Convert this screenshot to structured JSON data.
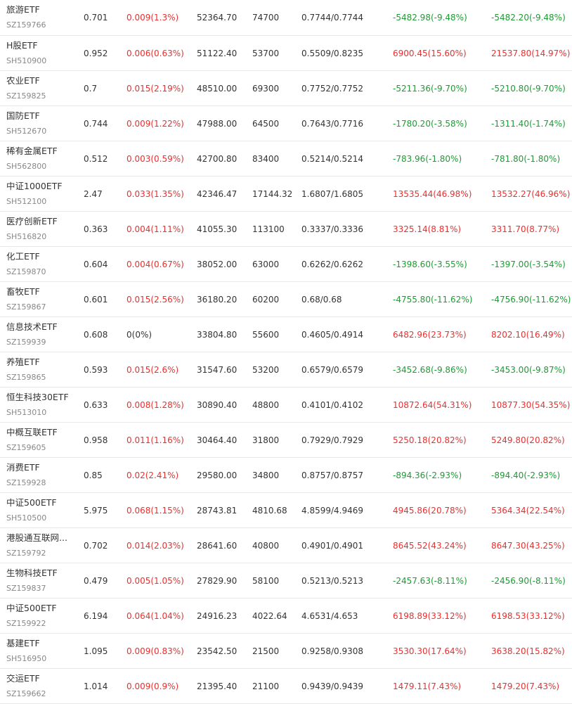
{
  "colors": {
    "up": "#e93030",
    "down": "#1e9b34",
    "flat": "#333333",
    "code_text": "#888888",
    "divider": "#e8e8e8"
  },
  "rows": [
    {
      "name": "旅游ETF",
      "code": "SZ159766",
      "price": "0.701",
      "change": "0.009(1.3%)",
      "change_dir": "up",
      "value": "52364.70",
      "shares": "74700",
      "cost": "0.7744/0.7744",
      "pl1": "-5482.98(-9.48%)",
      "pl1_dir": "down",
      "pl2": "-5482.20(-9.48%)",
      "pl2_dir": "down"
    },
    {
      "name": "H股ETF",
      "code": "SH510900",
      "price": "0.952",
      "change": "0.006(0.63%)",
      "change_dir": "up",
      "value": "51122.40",
      "shares": "53700",
      "cost": "0.5509/0.8235",
      "pl1": "6900.45(15.60%)",
      "pl1_dir": "up",
      "pl2": "21537.80(14.97%)",
      "pl2_dir": "up"
    },
    {
      "name": "农业ETF",
      "code": "SZ159825",
      "price": "0.7",
      "change": "0.015(2.19%)",
      "change_dir": "up",
      "value": "48510.00",
      "shares": "69300",
      "cost": "0.7752/0.7752",
      "pl1": "-5211.36(-9.70%)",
      "pl1_dir": "down",
      "pl2": "-5210.80(-9.70%)",
      "pl2_dir": "down"
    },
    {
      "name": "国防ETF",
      "code": "SH512670",
      "price": "0.744",
      "change": "0.009(1.22%)",
      "change_dir": "up",
      "value": "47988.00",
      "shares": "64500",
      "cost": "0.7643/0.7716",
      "pl1": "-1780.20(-3.58%)",
      "pl1_dir": "down",
      "pl2": "-1311.40(-1.74%)",
      "pl2_dir": "down"
    },
    {
      "name": "稀有金属ETF",
      "code": "SH562800",
      "price": "0.512",
      "change": "0.003(0.59%)",
      "change_dir": "up",
      "value": "42700.80",
      "shares": "83400",
      "cost": "0.5214/0.5214",
      "pl1": "-783.96(-1.80%)",
      "pl1_dir": "down",
      "pl2": "-781.80(-1.80%)",
      "pl2_dir": "down"
    },
    {
      "name": "中证1000ETF",
      "code": "SH512100",
      "price": "2.47",
      "change": "0.033(1.35%)",
      "change_dir": "up",
      "value": "42346.47",
      "shares": "17144.32",
      "cost": "1.6807/1.6805",
      "pl1": "13535.44(46.98%)",
      "pl1_dir": "up",
      "pl2": "13532.27(46.96%)",
      "pl2_dir": "up"
    },
    {
      "name": "医疗创新ETF",
      "code": "SH516820",
      "price": "0.363",
      "change": "0.004(1.11%)",
      "change_dir": "up",
      "value": "41055.30",
      "shares": "113100",
      "cost": "0.3337/0.3336",
      "pl1": "3325.14(8.81%)",
      "pl1_dir": "up",
      "pl2": "3311.70(8.77%)",
      "pl2_dir": "up"
    },
    {
      "name": "化工ETF",
      "code": "SZ159870",
      "price": "0.604",
      "change": "0.004(0.67%)",
      "change_dir": "up",
      "value": "38052.00",
      "shares": "63000",
      "cost": "0.6262/0.6262",
      "pl1": "-1398.60(-3.55%)",
      "pl1_dir": "down",
      "pl2": "-1397.00(-3.54%)",
      "pl2_dir": "down"
    },
    {
      "name": "畜牧ETF",
      "code": "SZ159867",
      "price": "0.601",
      "change": "0.015(2.56%)",
      "change_dir": "up",
      "value": "36180.20",
      "shares": "60200",
      "cost": "0.68/0.68",
      "pl1": "-4755.80(-11.62%)",
      "pl1_dir": "down",
      "pl2": "-4756.90(-11.62%)",
      "pl2_dir": "down"
    },
    {
      "name": "信息技术ETF",
      "code": "SZ159939",
      "price": "0.608",
      "change": "0(0%)",
      "change_dir": "flat",
      "value": "33804.80",
      "shares": "55600",
      "cost": "0.4605/0.4914",
      "pl1": "6482.96(23.73%)",
      "pl1_dir": "up",
      "pl2": "8202.10(16.49%)",
      "pl2_dir": "up"
    },
    {
      "name": "养殖ETF",
      "code": "SZ159865",
      "price": "0.593",
      "change": "0.015(2.6%)",
      "change_dir": "up",
      "value": "31547.60",
      "shares": "53200",
      "cost": "0.6579/0.6579",
      "pl1": "-3452.68(-9.86%)",
      "pl1_dir": "down",
      "pl2": "-3453.00(-9.87%)",
      "pl2_dir": "down"
    },
    {
      "name": "恒生科技30ETF",
      "code": "SH513010",
      "price": "0.633",
      "change": "0.008(1.28%)",
      "change_dir": "up",
      "value": "30890.40",
      "shares": "48800",
      "cost": "0.4101/0.4102",
      "pl1": "10872.64(54.31%)",
      "pl1_dir": "up",
      "pl2": "10877.30(54.35%)",
      "pl2_dir": "up"
    },
    {
      "name": "中概互联ETF",
      "code": "SZ159605",
      "price": "0.958",
      "change": "0.011(1.16%)",
      "change_dir": "up",
      "value": "30464.40",
      "shares": "31800",
      "cost": "0.7929/0.7929",
      "pl1": "5250.18(20.82%)",
      "pl1_dir": "up",
      "pl2": "5249.80(20.82%)",
      "pl2_dir": "up"
    },
    {
      "name": "消费ETF",
      "code": "SZ159928",
      "price": "0.85",
      "change": "0.02(2.41%)",
      "change_dir": "up",
      "value": "29580.00",
      "shares": "34800",
      "cost": "0.8757/0.8757",
      "pl1": "-894.36(-2.93%)",
      "pl1_dir": "down",
      "pl2": "-894.40(-2.93%)",
      "pl2_dir": "down"
    },
    {
      "name": "中证500ETF",
      "code": "SH510500",
      "price": "5.975",
      "change": "0.068(1.15%)",
      "change_dir": "up",
      "value": "28743.81",
      "shares": "4810.68",
      "cost": "4.8599/4.9469",
      "pl1": "4945.86(20.78%)",
      "pl1_dir": "up",
      "pl2": "5364.34(22.54%)",
      "pl2_dir": "up"
    },
    {
      "name": "港股通互联网...",
      "code": "SZ159792",
      "price": "0.702",
      "change": "0.014(2.03%)",
      "change_dir": "up",
      "value": "28641.60",
      "shares": "40800",
      "cost": "0.4901/0.4901",
      "pl1": "8645.52(43.24%)",
      "pl1_dir": "up",
      "pl2": "8647.30(43.25%)",
      "pl2_dir": "up"
    },
    {
      "name": "生物科技ETF",
      "code": "SZ159837",
      "price": "0.479",
      "change": "0.005(1.05%)",
      "change_dir": "up",
      "value": "27829.90",
      "shares": "58100",
      "cost": "0.5213/0.5213",
      "pl1": "-2457.63(-8.11%)",
      "pl1_dir": "down",
      "pl2": "-2456.90(-8.11%)",
      "pl2_dir": "down"
    },
    {
      "name": "中证500ETF",
      "code": "SZ159922",
      "price": "6.194",
      "change": "0.064(1.04%)",
      "change_dir": "up",
      "value": "24916.23",
      "shares": "4022.64",
      "cost": "4.6531/4.653",
      "pl1": "6198.89(33.12%)",
      "pl1_dir": "up",
      "pl2": "6198.53(33.12%)",
      "pl2_dir": "up"
    },
    {
      "name": "基建ETF",
      "code": "SH516950",
      "price": "1.095",
      "change": "0.009(0.83%)",
      "change_dir": "up",
      "value": "23542.50",
      "shares": "21500",
      "cost": "0.9258/0.9308",
      "pl1": "3530.30(17.64%)",
      "pl1_dir": "up",
      "pl2": "3638.20(15.82%)",
      "pl2_dir": "up"
    },
    {
      "name": "交运ETF",
      "code": "SZ159662",
      "price": "1.014",
      "change": "0.009(0.9%)",
      "change_dir": "up",
      "value": "21395.40",
      "shares": "21100",
      "cost": "0.9439/0.9439",
      "pl1": "1479.11(7.43%)",
      "pl1_dir": "up",
      "pl2": "1479.20(7.43%)",
      "pl2_dir": "up"
    }
  ]
}
